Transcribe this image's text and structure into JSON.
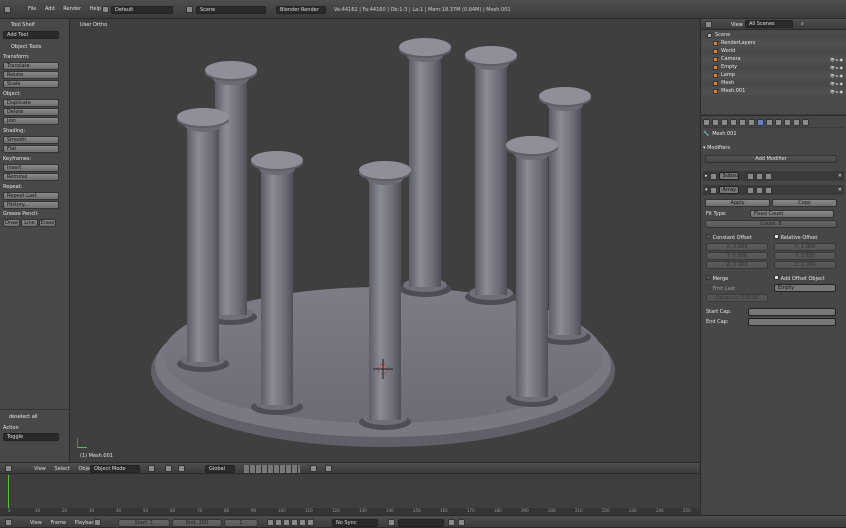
{
  "topbar": {
    "menu": [
      "File",
      "Add",
      "Render",
      "Help"
    ],
    "screen": "Default",
    "scene": "Scene",
    "engine": "Blender Render",
    "stats": "Ve:44162 | Fa:44160 | Ob:1-3 | La:1 | Mem:18.37M (0.84M) | Mesh.001"
  },
  "toolshelf": {
    "title": "Tool Shelf",
    "add_tool": "Add Tool",
    "object_tools": "Object Tools",
    "groups": [
      {
        "label": "Transform:",
        "buttons": [
          "Translate",
          "Rotate",
          "Scale"
        ]
      },
      {
        "label": "Object:",
        "buttons": [
          "Duplicate",
          "Delete",
          "Join"
        ]
      },
      {
        "label": "Shading:",
        "buttons": [
          "Smooth",
          "Flat"
        ]
      },
      {
        "label": "Keyframes:",
        "buttons": [
          "Insert",
          "Remove"
        ]
      },
      {
        "label": "Repeat:",
        "buttons": [
          "Repeat Last",
          "History..."
        ]
      }
    ],
    "grease_label": "Grease Pencil:",
    "grease_buttons": [
      "Draw",
      "Line",
      "Erase"
    ],
    "last_op": "deselect all",
    "action_label": "Action",
    "action_value": "Toggle"
  },
  "viewport": {
    "view_name": "User Ortho",
    "object_name": "(1) Mesh.001"
  },
  "header3d": {
    "menu": [
      "View",
      "Select",
      "Object"
    ],
    "mode": "Object Mode",
    "orientation": "Global"
  },
  "outliner": {
    "view": "View",
    "search": "All Scenes",
    "items": [
      {
        "name": "Scene",
        "indent": 0
      },
      {
        "name": "RenderLayers",
        "indent": 1
      },
      {
        "name": "World",
        "indent": 1
      },
      {
        "name": "Camera",
        "indent": 1
      },
      {
        "name": "Empty",
        "indent": 1
      },
      {
        "name": "Lamp",
        "indent": 1
      },
      {
        "name": "Mesh",
        "indent": 1
      },
      {
        "name": "Mesh.001",
        "indent": 1
      }
    ]
  },
  "properties": {
    "object_path": "Mesh.001",
    "modifiers_title": "Modifiers",
    "add_modifier": "Add Modifier",
    "mod1_name": "Subsurf",
    "mod2_name": "Array",
    "apply": "Apply",
    "copy": "Copy",
    "fit_type_label": "Fit Type:",
    "fit_type": "Fixed Count",
    "count": "Count: 8",
    "constant_offset": "Constant Offset",
    "relative_offset": "Relative Offset",
    "const_vals": [
      "X: 0.000",
      "Y: 0.000",
      "Z: 0.000"
    ],
    "rel_vals": [
      "X: 1.000",
      "Y: 0.000",
      "Z: 0.000"
    ],
    "merge": "Merge",
    "first_last": "First Last",
    "distance": "Distance: 0.0100",
    "object_offset": "Add Offset Object",
    "object_value": "Empty",
    "start_cap": "Start Cap:",
    "end_cap": "End Cap:"
  },
  "timeline": {
    "menu": [
      "View",
      "Frame",
      "Playback"
    ],
    "start": "Start: 1",
    "end": "End: 250",
    "current": "1",
    "sync": "No Sync",
    "ticks": [
      "0",
      "10",
      "20",
      "30",
      "40",
      "50",
      "60",
      "70",
      "80",
      "90",
      "100",
      "110",
      "120",
      "130",
      "140",
      "150",
      "160",
      "170",
      "180",
      "190",
      "200",
      "210",
      "220",
      "230",
      "240",
      "250"
    ]
  }
}
